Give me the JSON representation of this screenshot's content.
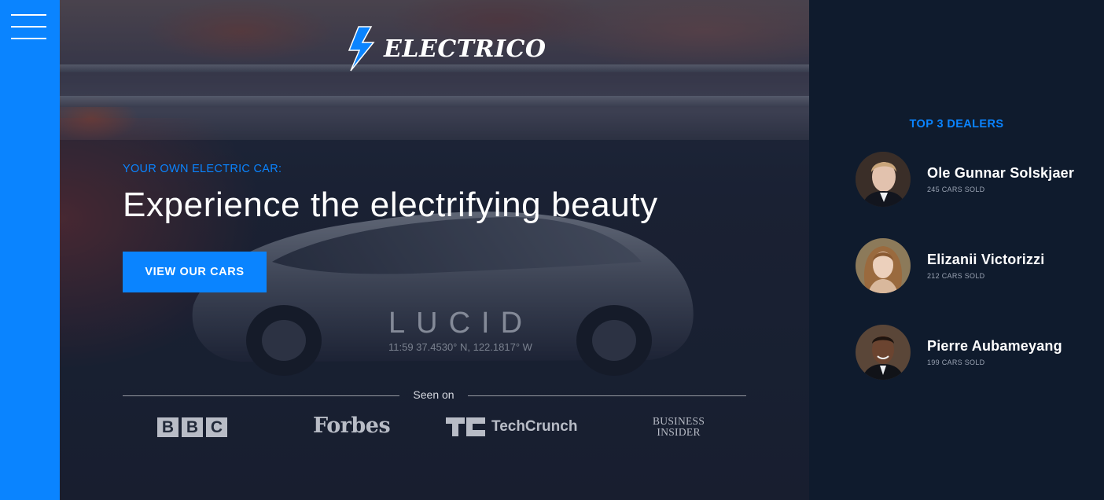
{
  "brand": {
    "name": "ELECTRICO"
  },
  "hero": {
    "eyebrow": "YOUR OWN ELECTRIC CAR:",
    "headline": "Experience the electrifying beauty",
    "cta_label": "VIEW OUR CARS",
    "car_badge": "LUCID",
    "car_coordinates": "11:59    37.4530° N, 122.1817° W"
  },
  "press": {
    "label": "Seen on",
    "bbc_letters": [
      "B",
      "B",
      "C"
    ],
    "forbes": "Forbes",
    "techcrunch": "TechCrunch",
    "business_insider_line1": "BUSINESS",
    "business_insider_line2": "INSIDER"
  },
  "dealers": {
    "title": "TOP 3 DEALERS",
    "items": [
      {
        "name": "Ole Gunnar Solskjaer",
        "sold": "245 CARS SOLD"
      },
      {
        "name": "Elizanii Victorizzi",
        "sold": "212 CARS SOLD"
      },
      {
        "name": "Pierre Aubameyang",
        "sold": "199 CARS SOLD"
      }
    ]
  },
  "colors": {
    "accent": "#0a84ff",
    "panel_bg": "#0f1b2d",
    "text": "#ffffff"
  },
  "icons": {
    "menu": "hamburger-menu-icon",
    "logo": "lightning-bolt-icon"
  }
}
